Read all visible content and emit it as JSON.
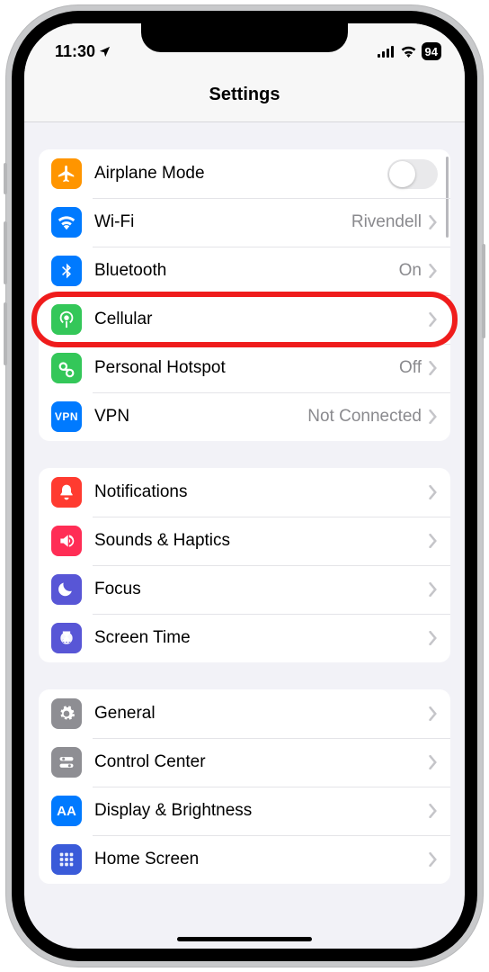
{
  "status": {
    "time": "11:30",
    "battery": "94"
  },
  "header": {
    "title": "Settings"
  },
  "groups": [
    {
      "rows": [
        {
          "icon": "airplane",
          "bg": "#ff9500",
          "label": "Airplane Mode",
          "control": "toggle"
        },
        {
          "icon": "wifi",
          "bg": "#007aff",
          "label": "Wi-Fi",
          "value": "Rivendell",
          "control": "link"
        },
        {
          "icon": "bluetooth",
          "bg": "#007aff",
          "label": "Bluetooth",
          "value": "On",
          "control": "link"
        },
        {
          "icon": "cellular",
          "bg": "#34c759",
          "label": "Cellular",
          "control": "link",
          "highlight": true
        },
        {
          "icon": "hotspot",
          "bg": "#34c759",
          "label": "Personal Hotspot",
          "value": "Off",
          "control": "link"
        },
        {
          "icon": "vpn",
          "bg": "#007aff",
          "label": "VPN",
          "value": "Not Connected",
          "control": "link"
        }
      ]
    },
    {
      "rows": [
        {
          "icon": "notifications",
          "bg": "#ff3b30",
          "label": "Notifications",
          "control": "link"
        },
        {
          "icon": "sounds",
          "bg": "#ff2d55",
          "label": "Sounds & Haptics",
          "control": "link"
        },
        {
          "icon": "focus",
          "bg": "#5856d6",
          "label": "Focus",
          "control": "link"
        },
        {
          "icon": "screentime",
          "bg": "#5856d6",
          "label": "Screen Time",
          "control": "link"
        }
      ]
    },
    {
      "rows": [
        {
          "icon": "general",
          "bg": "#8e8e93",
          "label": "General",
          "control": "link"
        },
        {
          "icon": "controlcenter",
          "bg": "#8e8e93",
          "label": "Control Center",
          "control": "link"
        },
        {
          "icon": "display",
          "bg": "#007aff",
          "label": "Display & Brightness",
          "control": "link"
        },
        {
          "icon": "homescreen",
          "bg": "#3355cc",
          "label": "Home Screen",
          "control": "link"
        }
      ]
    }
  ]
}
